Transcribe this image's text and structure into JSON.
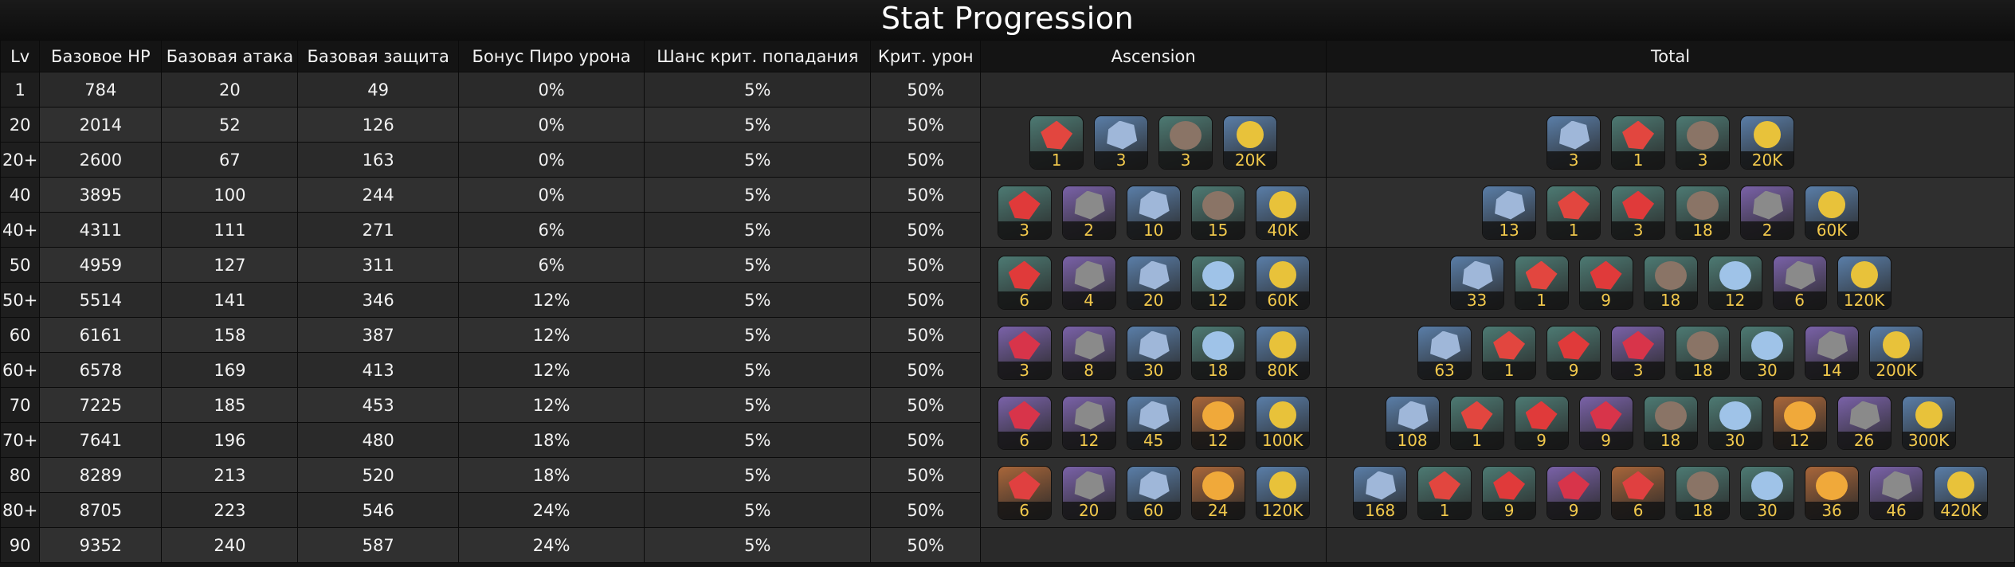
{
  "title": "Stat Progression",
  "headers": [
    "Lv",
    "Базовое HP",
    "Базовая атака",
    "Базовая защита",
    "Бонус Пиро урона",
    "Шанс крит. попадания",
    "Крит. урон",
    "Ascension",
    "Total"
  ],
  "rows": [
    [
      "1",
      "784",
      "20",
      "49",
      "0%",
      "5%",
      "50%"
    ],
    [
      "20",
      "2014",
      "52",
      "126",
      "0%",
      "5%",
      "50%"
    ],
    [
      "20+",
      "2600",
      "67",
      "163",
      "0%",
      "5%",
      "50%"
    ],
    [
      "40",
      "3895",
      "100",
      "244",
      "0%",
      "5%",
      "50%"
    ],
    [
      "40+",
      "4311",
      "111",
      "271",
      "6%",
      "5%",
      "50%"
    ],
    [
      "50",
      "4959",
      "127",
      "311",
      "6%",
      "5%",
      "50%"
    ],
    [
      "50+",
      "5514",
      "141",
      "346",
      "12%",
      "5%",
      "50%"
    ],
    [
      "60",
      "6161",
      "158",
      "387",
      "12%",
      "5%",
      "50%"
    ],
    [
      "60+",
      "6578",
      "169",
      "413",
      "12%",
      "5%",
      "50%"
    ],
    [
      "70",
      "7225",
      "185",
      "453",
      "12%",
      "5%",
      "50%"
    ],
    [
      "70+",
      "7641",
      "196",
      "480",
      "18%",
      "5%",
      "50%"
    ],
    [
      "80",
      "8289",
      "213",
      "520",
      "18%",
      "5%",
      "50%"
    ],
    [
      "80+",
      "8705",
      "223",
      "546",
      "24%",
      "5%",
      "50%"
    ],
    [
      "90",
      "9352",
      "240",
      "587",
      "24%",
      "5%",
      "50%"
    ]
  ],
  "ascension": [
    [
      {
        "icon": "red-flower-icon",
        "count": "1"
      },
      {
        "icon": "blue-ore-icon",
        "count": "3"
      },
      {
        "icon": "brown-shell-icon",
        "count": "3"
      },
      {
        "icon": "mora-coin-icon",
        "count": "20K"
      }
    ],
    [
      {
        "icon": "red-gem-sliver-icon",
        "count": "3"
      },
      {
        "icon": "grey-chunk-icon",
        "count": "2"
      },
      {
        "icon": "blue-ore-icon",
        "count": "10"
      },
      {
        "icon": "brown-shell-icon",
        "count": "15"
      },
      {
        "icon": "mora-coin-icon",
        "count": "40K"
      }
    ],
    [
      {
        "icon": "red-gem-sliver-icon",
        "count": "6"
      },
      {
        "icon": "grey-chunk-icon",
        "count": "4"
      },
      {
        "icon": "blue-ore-icon",
        "count": "20"
      },
      {
        "icon": "blue-spiral-icon",
        "count": "12"
      },
      {
        "icon": "mora-coin-icon",
        "count": "60K"
      }
    ],
    [
      {
        "icon": "red-gem-fragment-icon",
        "count": "3"
      },
      {
        "icon": "grey-chunk-icon",
        "count": "8"
      },
      {
        "icon": "blue-ore-icon",
        "count": "30"
      },
      {
        "icon": "blue-spiral-icon",
        "count": "18"
      },
      {
        "icon": "mora-coin-icon",
        "count": "80K"
      }
    ],
    [
      {
        "icon": "red-gem-fragment-icon",
        "count": "6"
      },
      {
        "icon": "grey-chunk-icon",
        "count": "12"
      },
      {
        "icon": "blue-ore-icon",
        "count": "45"
      },
      {
        "icon": "gold-spiral-icon",
        "count": "12"
      },
      {
        "icon": "mora-coin-icon",
        "count": "100K"
      }
    ],
    [
      {
        "icon": "red-gem-chunk-icon",
        "count": "6"
      },
      {
        "icon": "grey-chunk-icon",
        "count": "20"
      },
      {
        "icon": "blue-ore-icon",
        "count": "60"
      },
      {
        "icon": "gold-spiral-icon",
        "count": "24"
      },
      {
        "icon": "mora-coin-icon",
        "count": "120K"
      }
    ]
  ],
  "total": [
    [
      {
        "icon": "blue-ore-icon",
        "count": "3"
      },
      {
        "icon": "red-flower-icon",
        "count": "1"
      },
      {
        "icon": "brown-shell-icon",
        "count": "3"
      },
      {
        "icon": "mora-coin-icon",
        "count": "20K"
      }
    ],
    [
      {
        "icon": "blue-ore-icon",
        "count": "13"
      },
      {
        "icon": "red-flower-icon",
        "count": "1"
      },
      {
        "icon": "red-gem-sliver-icon",
        "count": "3"
      },
      {
        "icon": "brown-shell-icon",
        "count": "18"
      },
      {
        "icon": "grey-chunk-icon",
        "count": "2"
      },
      {
        "icon": "mora-coin-icon",
        "count": "60K"
      }
    ],
    [
      {
        "icon": "blue-ore-icon",
        "count": "33"
      },
      {
        "icon": "red-flower-icon",
        "count": "1"
      },
      {
        "icon": "red-gem-sliver-icon",
        "count": "9"
      },
      {
        "icon": "brown-shell-icon",
        "count": "18"
      },
      {
        "icon": "blue-spiral-icon",
        "count": "12"
      },
      {
        "icon": "grey-chunk-icon",
        "count": "6"
      },
      {
        "icon": "mora-coin-icon",
        "count": "120K"
      }
    ],
    [
      {
        "icon": "blue-ore-icon",
        "count": "63"
      },
      {
        "icon": "red-flower-icon",
        "count": "1"
      },
      {
        "icon": "red-gem-sliver-icon",
        "count": "9"
      },
      {
        "icon": "red-gem-fragment-icon",
        "count": "3"
      },
      {
        "icon": "brown-shell-icon",
        "count": "18"
      },
      {
        "icon": "blue-spiral-icon",
        "count": "30"
      },
      {
        "icon": "grey-chunk-icon",
        "count": "14"
      },
      {
        "icon": "mora-coin-icon",
        "count": "200K"
      }
    ],
    [
      {
        "icon": "blue-ore-icon",
        "count": "108"
      },
      {
        "icon": "red-flower-icon",
        "count": "1"
      },
      {
        "icon": "red-gem-sliver-icon",
        "count": "9"
      },
      {
        "icon": "red-gem-fragment-icon",
        "count": "9"
      },
      {
        "icon": "brown-shell-icon",
        "count": "18"
      },
      {
        "icon": "blue-spiral-icon",
        "count": "30"
      },
      {
        "icon": "gold-spiral-icon",
        "count": "12"
      },
      {
        "icon": "grey-chunk-icon",
        "count": "26"
      },
      {
        "icon": "mora-coin-icon",
        "count": "300K"
      }
    ],
    [
      {
        "icon": "blue-ore-icon",
        "count": "168"
      },
      {
        "icon": "red-flower-icon",
        "count": "1"
      },
      {
        "icon": "red-gem-sliver-icon",
        "count": "9"
      },
      {
        "icon": "red-gem-fragment-icon",
        "count": "9"
      },
      {
        "icon": "red-gem-chunk-icon",
        "count": "6"
      },
      {
        "icon": "brown-shell-icon",
        "count": "18"
      },
      {
        "icon": "blue-spiral-icon",
        "count": "30"
      },
      {
        "icon": "gold-spiral-icon",
        "count": "36"
      },
      {
        "icon": "grey-chunk-icon",
        "count": "46"
      },
      {
        "icon": "mora-coin-icon",
        "count": "420K"
      }
    ]
  ],
  "colors": {
    "count_text": "#f2c94c",
    "rarity_green": "#4d7a73",
    "rarity_blue": "#5a7ea8",
    "rarity_purple": "#7a62a8",
    "rarity_orange": "#a8663a"
  }
}
